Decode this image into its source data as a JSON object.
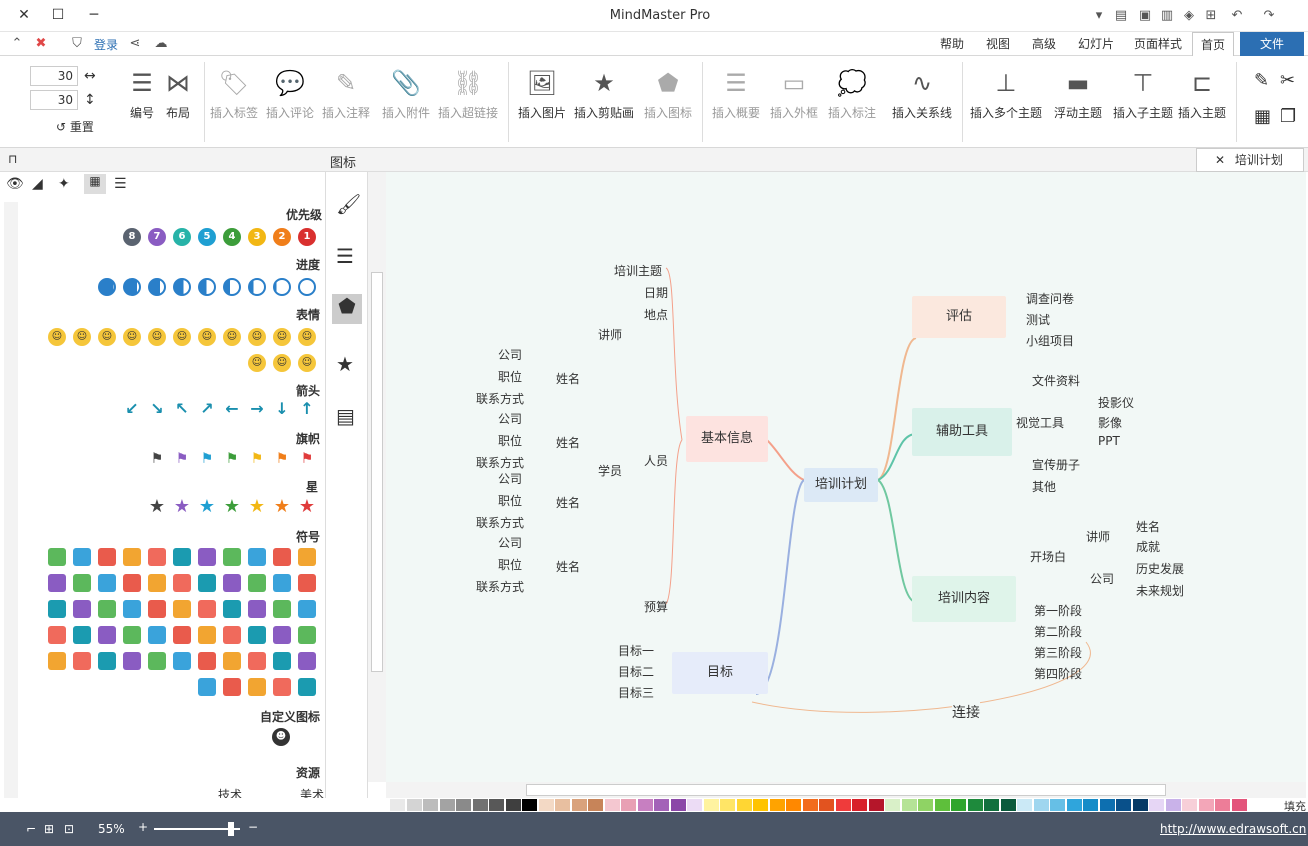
{
  "window": {
    "title": "MindMaster Pro",
    "minimize": "─",
    "maximize": "☐",
    "close": "✕"
  },
  "quickbar": {
    "login": "登录"
  },
  "tabs": [
    "文件",
    "首页",
    "页面样式",
    "幻灯片",
    "高级",
    "视图",
    "帮助"
  ],
  "ribbon": {
    "buttons": [
      {
        "label": "插入主题",
        "icon": "topic-icon"
      },
      {
        "label": "插入子主题",
        "icon": "subtopic-icon"
      },
      {
        "label": "浮动主题",
        "icon": "floating-topic-icon"
      },
      {
        "label": "插入多个主题",
        "icon": "multi-topic-icon"
      },
      {
        "label": "插入关系线",
        "icon": "relation-icon"
      },
      {
        "label": "插入标注",
        "icon": "callout-icon"
      },
      {
        "label": "插入外框",
        "icon": "boundary-icon"
      },
      {
        "label": "插入概要",
        "icon": "summary-icon"
      },
      {
        "label": "插入图标",
        "icon": "icon-icon"
      },
      {
        "label": "插入剪贴画",
        "icon": "clipart-icon"
      },
      {
        "label": "插入图片",
        "icon": "picture-icon"
      },
      {
        "label": "插入超链接",
        "icon": "link-icon"
      },
      {
        "label": "插入附件",
        "icon": "attachment-icon"
      },
      {
        "label": "插入注释",
        "icon": "note-icon"
      },
      {
        "label": "插入评论",
        "icon": "comment-icon"
      },
      {
        "label": "插入标签",
        "icon": "tag-icon"
      },
      {
        "label": "布局",
        "icon": "layout-icon"
      },
      {
        "label": "编号",
        "icon": "numbering-icon"
      }
    ],
    "spin1": "30",
    "spin2": "30",
    "reset": "重置"
  },
  "document_tab": "培训计划",
  "panel": {
    "title": "图标",
    "sections": {
      "priority": "优先级",
      "progress": "进度",
      "emotion": "表情",
      "arrow": "箭头",
      "flag": "旗帜",
      "star": "星",
      "symbol": "符号",
      "custom": "自定义图标",
      "resource": "资源"
    },
    "priority_nums": [
      "1",
      "2",
      "3",
      "4",
      "5",
      "6",
      "7",
      "8"
    ],
    "resource_items": [
      "技术",
      "美术"
    ]
  },
  "mindmap": {
    "central": "培训计划",
    "basic": "基本信息",
    "basic_children": [
      "培训主题",
      "日期",
      "地点",
      "讲师",
      "人员",
      "学员",
      "预算"
    ],
    "person": "姓名",
    "person_fields": [
      "公司",
      "职位",
      "联系方式"
    ],
    "goal": "目标",
    "goals": [
      "目标一",
      "目标二",
      "目标三"
    ],
    "eval": "评估",
    "eval_children": [
      "调查问卷",
      "测试",
      "小组项目"
    ],
    "tools": "辅助工具",
    "tools_children": [
      "文件资料",
      "视觉工具",
      "投影仪",
      "影像",
      "PPT",
      "宣传册子",
      "其他"
    ],
    "content": "培训内容",
    "content_children": [
      "开场白",
      "讲师",
      "姓名",
      "成就",
      "公司",
      "历史发展",
      "未来规划",
      "第一阶段",
      "第二阶段",
      "第三阶段",
      "第四阶段"
    ],
    "relation": "连接"
  },
  "status": {
    "url": "http://www.edrawsoft.cn",
    "zoom": "55%",
    "palette_label": "填充"
  },
  "colors": {
    "canvas": "#f2f8f6",
    "accent": "#2c6fb3",
    "status": "#4a5566"
  }
}
